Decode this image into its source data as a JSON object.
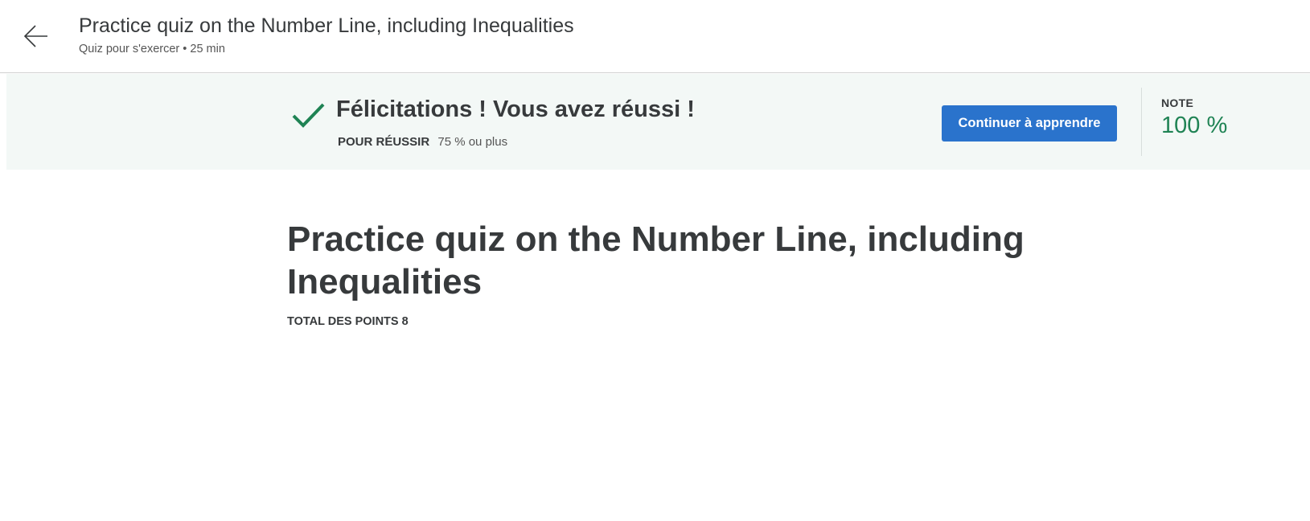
{
  "header": {
    "title": "Practice quiz on the Number Line, including Inequalities",
    "subtitle": "Quiz pour s'exercer • 25  min",
    "back_icon": "arrow-left-icon"
  },
  "banner": {
    "message": "Félicitations ! Vous avez réussi !",
    "pass_label": "POUR RÉUSSIR",
    "pass_value": "75 % ou plus",
    "continue_label": "Continuer à apprendre",
    "grade_label": "NOTE",
    "grade_value": "100 %",
    "status_icon": "checkmark-icon",
    "colors": {
      "banner_bg": "#f3f8f6",
      "check": "#1f8354",
      "button": "#2a73cc",
      "grade": "#1f8354"
    }
  },
  "main": {
    "title": "Practice quiz on the Number Line, including Inequalities",
    "total_points": "TOTAL DES POINTS 8"
  }
}
